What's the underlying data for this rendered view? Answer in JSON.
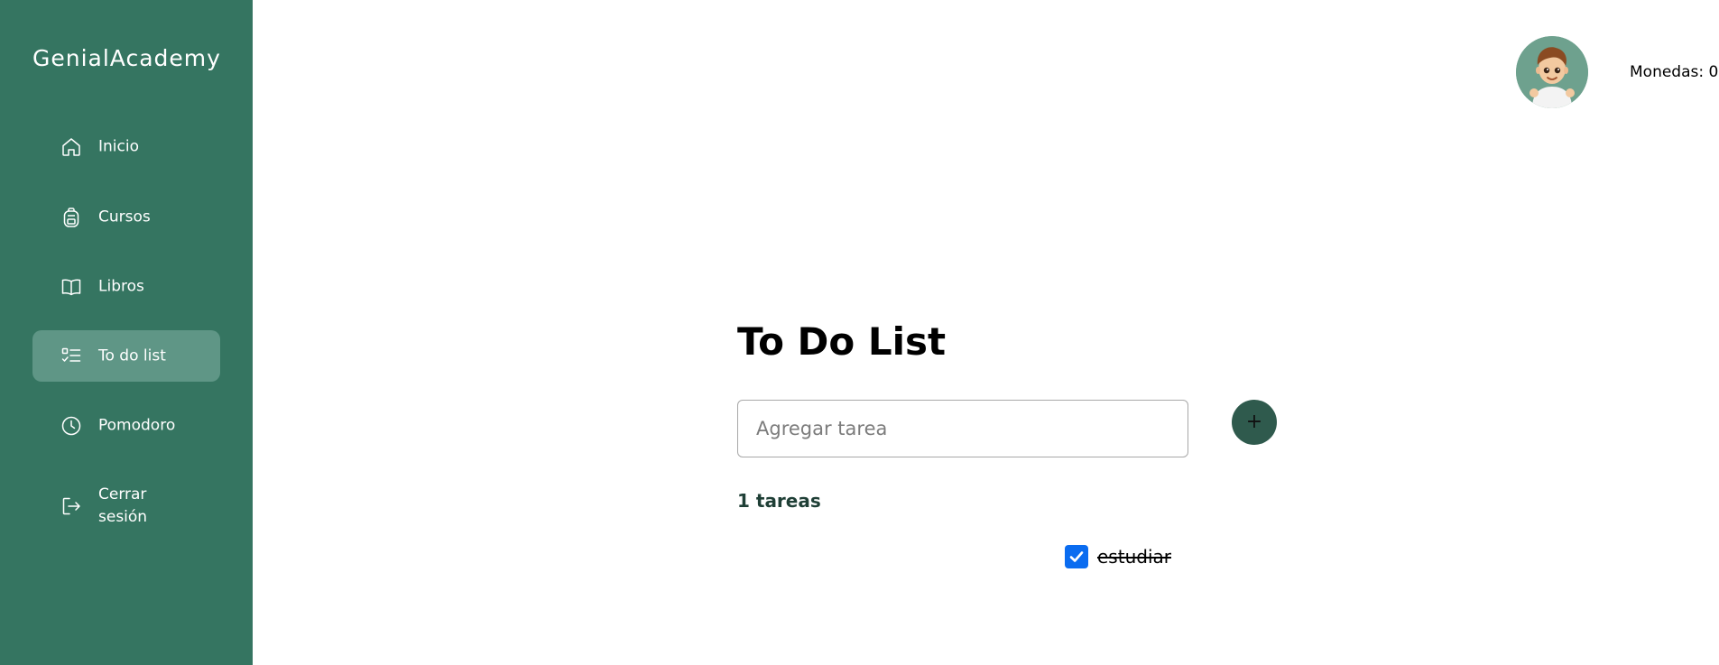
{
  "sidebar": {
    "brand": "GenialAcademy",
    "items": [
      {
        "label": "Inicio",
        "icon": "home-icon"
      },
      {
        "label": "Cursos",
        "icon": "backpack-icon"
      },
      {
        "label": "Libros",
        "icon": "book-icon"
      },
      {
        "label": "To do list",
        "icon": "checklist-icon",
        "active": true
      },
      {
        "label": "Pomodoro",
        "icon": "clock-icon"
      },
      {
        "label": "Cerrar sesión",
        "icon": "logout-icon"
      }
    ]
  },
  "header": {
    "coins_label": "Monedas: 0",
    "avatar_icon": "avatar-boy"
  },
  "main": {
    "title": "To Do List",
    "input_placeholder": "Agregar tarea",
    "input_value": "",
    "add_button_label": "+",
    "task_count": "1 tareas",
    "tasks": [
      {
        "text": "estudiar",
        "done": true
      }
    ]
  },
  "colors": {
    "sidebar_bg": "#357561",
    "sidebar_active": "#5f9686",
    "add_button": "#2f5a4d",
    "checkbox": "#0a6cf0"
  }
}
